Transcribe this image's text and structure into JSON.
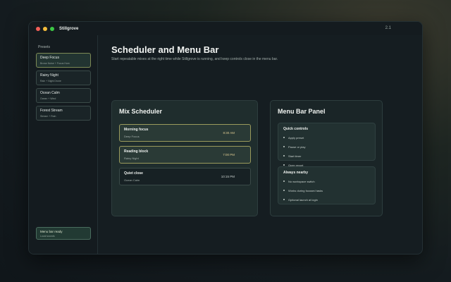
{
  "window": {
    "app_title": "Stillgrove",
    "version": "2.1"
  },
  "sidebar": {
    "heading": "Presets",
    "presets": [
      {
        "name": "Deep Focus",
        "sub": "Brown Noise + Focus Hum",
        "active": true
      },
      {
        "name": "Rainy Night",
        "sub": "Rain + Night Drone",
        "active": false
      },
      {
        "name": "Ocean Calm",
        "sub": "Ocean + Wind",
        "active": false
      },
      {
        "name": "Forest Stream",
        "sub": "Stream + Rain",
        "active": false
      }
    ],
    "status": {
      "title": "Menu bar ready",
      "sub": "Local sounds"
    }
  },
  "main": {
    "title": "Scheduler and Menu Bar",
    "subtitle": "Start repeatable mixes at the right time while Stillgrove is running, and keep controls close in the menu bar."
  },
  "scheduler": {
    "title": "Mix Scheduler",
    "mixes": [
      {
        "name": "Morning focus",
        "sub": "Deep Focus",
        "time": "8:30 AM"
      },
      {
        "name": "Reading block",
        "sub": "Rainy Night",
        "time": "7:00 PM"
      },
      {
        "name": "Quiet close",
        "sub": "Ocean Calm",
        "time": "10:15 PM"
      }
    ]
  },
  "menubar_panel": {
    "title": "Menu Bar Panel",
    "quick_controls": {
      "title": "Quick controls",
      "items": [
        "Apply preset",
        "Pause or play",
        "Start timer",
        "Open report"
      ]
    },
    "always_nearby": {
      "title": "Always nearby",
      "items": [
        "No workspace switch",
        "Works during focused tasks",
        "Optional launch at login"
      ]
    }
  }
}
